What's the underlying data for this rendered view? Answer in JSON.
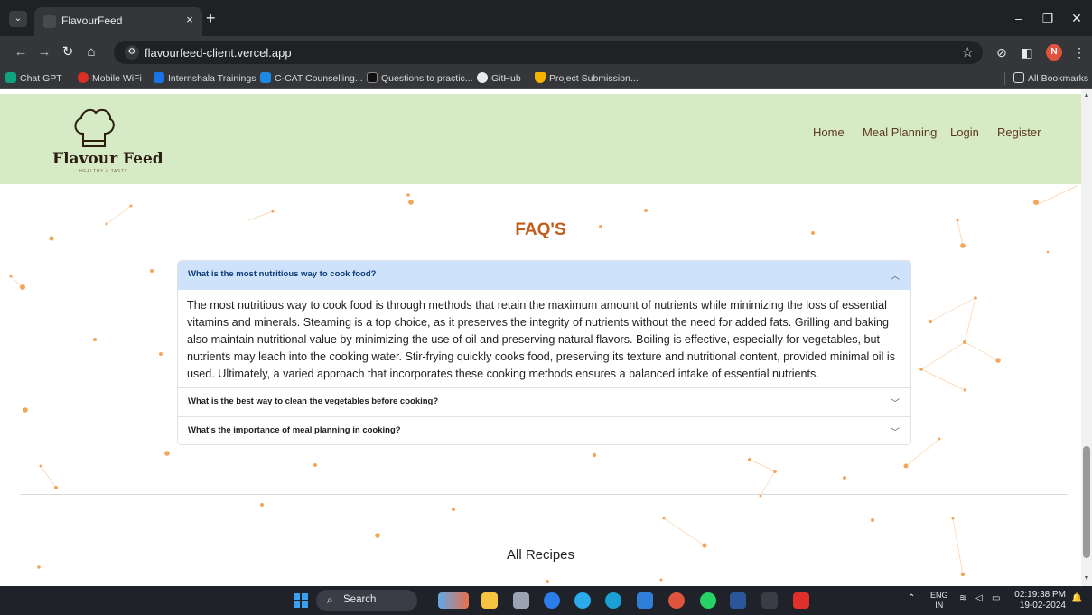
{
  "browser": {
    "tab_title": "FlavourFeed",
    "tab_close": "×",
    "new_tab": "+",
    "url": "flavourfeed-client.vercel.app",
    "profile_initial": "N",
    "bookmarks": [
      {
        "label": "Chat GPT",
        "color": "#10a37f"
      },
      {
        "label": "Mobile WiFi",
        "color": "#d93025"
      },
      {
        "label": "Internshala Trainings",
        "color": "#1a73e8"
      },
      {
        "label": "C-CAT Counselling...",
        "color": "#1e88e5"
      },
      {
        "label": "Questions to practic...",
        "color": "#111111"
      },
      {
        "label": "GitHub",
        "color": "#e8eaed"
      },
      {
        "label": "Project Submission...",
        "color": "#f4b400"
      }
    ],
    "all_bookmarks": "All Bookmarks"
  },
  "site": {
    "logo_text": "Flavour Feed",
    "logo_tagline": "HEALTHY & TASTY",
    "nav": [
      "Home",
      "Meal Planning",
      "Login",
      "Register"
    ],
    "faq_title": "FAQ'S",
    "faqs": [
      {
        "question": "What is the most nutritious way to cook food?",
        "expanded": true,
        "answer": "The most nutritious way to cook food is through methods that retain the maximum amount of nutrients while minimizing the loss of essential vitamins and minerals. Steaming is a top choice, as it preserves the integrity of nutrients without the need for added fats. Grilling and baking also maintain nutritional value by minimizing the use of oil and preserving natural flavors. Boiling is effective, especially for vegetables, but nutrients may leach into the cooking water. Stir-frying quickly cooks food, preserving its texture and nutritional content, provided minimal oil is used. Ultimately, a varied approach that incorporates these cooking methods ensures a balanced intake of essential nutrients."
      },
      {
        "question": "What is the best way to clean the vegetables before cooking?",
        "expanded": false
      },
      {
        "question": "What's the importance of meal planning in cooking?",
        "expanded": false
      }
    ],
    "all_recipes_title": "All Recipes",
    "colors": {
      "header_bg": "#d6ebc5",
      "accent": "#c15c1d",
      "particle": "#f5a55a"
    }
  },
  "taskbar": {
    "search_label": "Search",
    "lang_top": "ENG",
    "lang_bottom": "IN",
    "time": "02:19:38 PM",
    "date": "19-02-2024"
  }
}
